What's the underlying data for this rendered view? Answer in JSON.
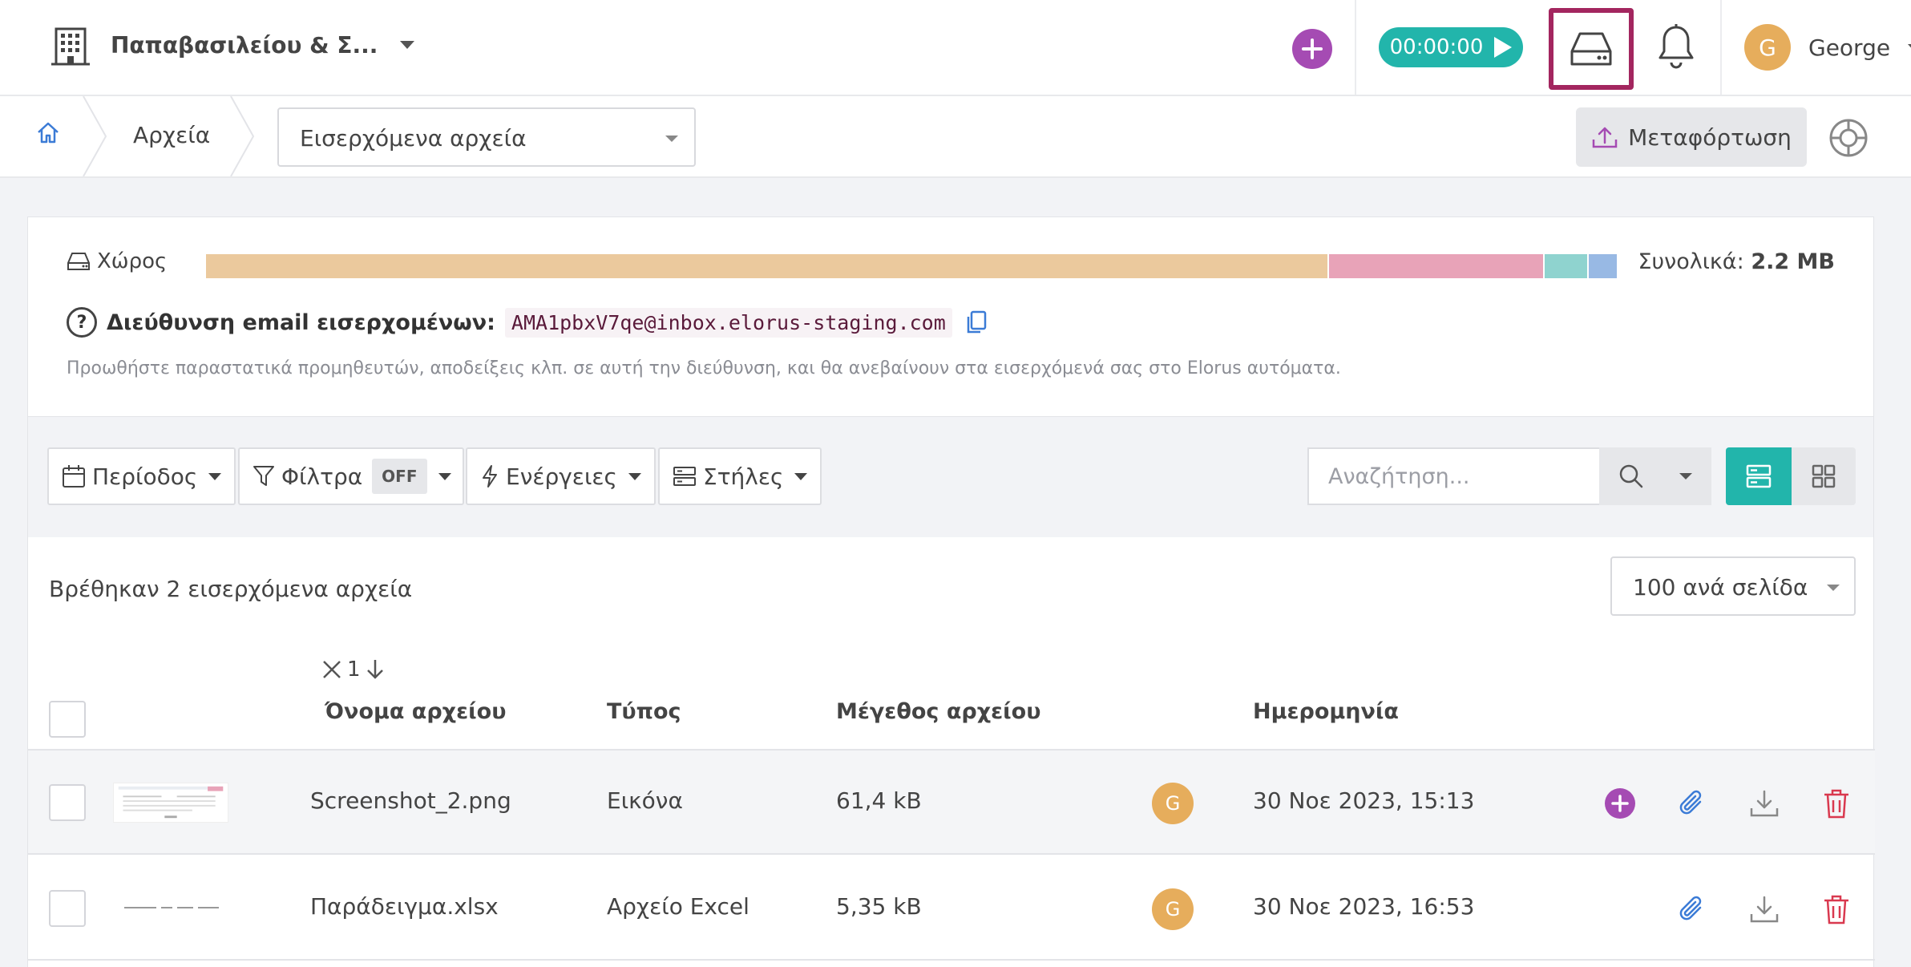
{
  "header": {
    "company_name": "Παπαβασιλείου & Σ...",
    "timer": "00:00:00",
    "user_initial": "G",
    "user_name": "George"
  },
  "breadcrumb": {
    "item": "Αρχεία",
    "select_value": "Εισερχόμενα αρχεία",
    "upload_label": "Μεταφόρτωση"
  },
  "storage": {
    "label": "Χώρος",
    "total_label": "Συνολικά:",
    "total_value": "2.2 MB",
    "segments": [
      {
        "color": "#ebc99d",
        "fraction": 0.795
      },
      {
        "color": "#e8a3b8",
        "fraction": 0.153
      },
      {
        "color": "#8fd3cf",
        "fraction": 0.031
      },
      {
        "color": "#98b9e4",
        "fraction": 0.021
      }
    ],
    "email_label": "Διεύθυνση email εισερχομένων:",
    "email_value": "AMA1pbxV7qe@inbox.elorus-staging.com",
    "hint": "Προωθήστε παραστατικά προμηθευτών, αποδείξεις κλπ. σε αυτή την διεύθυνση, και θα ανεβαίνουν στα εισερχόμενά σας στο Elorus αυτόματα."
  },
  "toolbar": {
    "period_label": "Περίοδος",
    "filters_label": "Φίλτρα",
    "filters_state": "OFF",
    "actions_label": "Ενέργειες",
    "columns_label": "Στήλες",
    "search_placeholder": "Αναζήτηση..."
  },
  "table": {
    "found_text": "Βρέθηκαν 2 εισερχόμενα αρχεία",
    "per_page": "100 ανά σελίδα",
    "sort_index": "1",
    "columns": {
      "name": "Όνομα αρχείου",
      "type": "Τύπος",
      "size": "Μέγεθος αρχείου",
      "date": "Ημερομηνία"
    },
    "rows": [
      {
        "name": "Screenshot_2.png",
        "type": "Εικόνα",
        "size": "61,4 kB",
        "user": "G",
        "date": "30 Νοε 2023, 15:13"
      },
      {
        "name": "Παράδειγμα.xlsx",
        "type": "Αρχείο Excel",
        "size": "5,35 kB",
        "user": "G",
        "date": "30 Νοε 2023, 16:53"
      }
    ]
  },
  "colors": {
    "accent_teal": "#22b5ab",
    "accent_purple": "#a54bb3",
    "highlight_border": "#a3265f",
    "delete_red": "#d9394f",
    "link_blue": "#3b7bd6"
  }
}
